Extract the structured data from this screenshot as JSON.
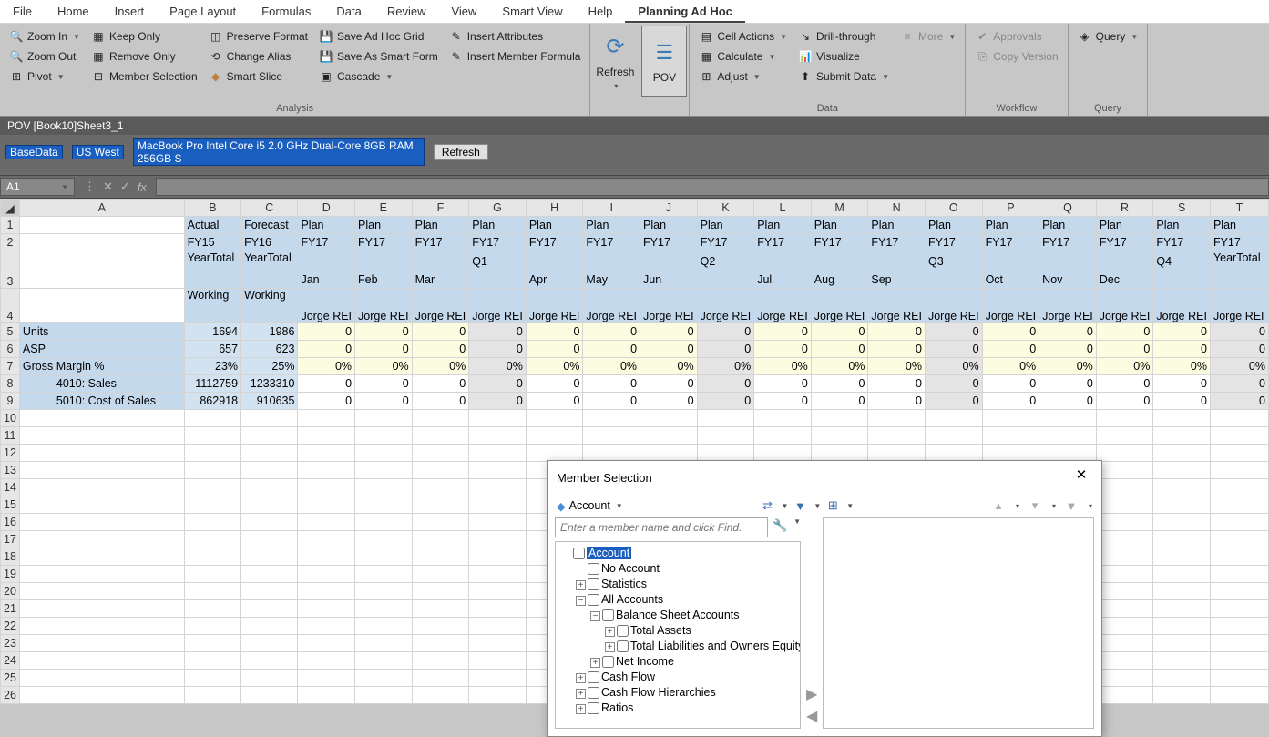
{
  "menu": [
    "File",
    "Home",
    "Insert",
    "Page Layout",
    "Formulas",
    "Data",
    "Review",
    "View",
    "Smart View",
    "Help",
    "Planning Ad Hoc"
  ],
  "menu_active": 10,
  "ribbon": {
    "analysis": {
      "label": "Analysis",
      "col1": [
        "Zoom In",
        "Zoom Out",
        "Pivot"
      ],
      "col2": [
        "Keep Only",
        "Remove Only",
        "Member Selection"
      ],
      "col3": [
        "Preserve Format",
        "Change Alias",
        "Smart Slice"
      ],
      "col4": [
        "Save Ad Hoc Grid",
        "Save As Smart Form",
        "Cascade"
      ],
      "col5": [
        "Insert Attributes",
        "Insert Member Formula"
      ]
    },
    "refresh": "Refresh",
    "pov": "POV",
    "data": {
      "label": "Data",
      "col1": [
        "Cell Actions",
        "Calculate",
        "Adjust"
      ],
      "col2": [
        "Drill-through",
        "Visualize",
        "Submit Data"
      ],
      "col3": [
        "More"
      ]
    },
    "workflow": {
      "label": "Workflow",
      "col1": [
        "Approvals",
        "Copy Version"
      ]
    },
    "query": {
      "label": "Query",
      "col1": [
        "Query"
      ]
    }
  },
  "pov": {
    "title": "POV [Book10]Sheet3_1",
    "chips": [
      "BaseData",
      "US West",
      "MacBook Pro Intel Core i5 2.0 GHz Dual-Core 8GB RAM  256GB S"
    ],
    "refresh": "Refresh"
  },
  "namebox": "A1",
  "cols": [
    "A",
    "B",
    "C",
    "D",
    "E",
    "F",
    "G",
    "H",
    "I",
    "J",
    "K",
    "L",
    "M",
    "N",
    "O",
    "P",
    "Q",
    "R",
    "S",
    "T"
  ],
  "grid": {
    "row1": [
      "",
      "Actual",
      "Forecast",
      "Plan",
      "Plan",
      "Plan",
      "Plan",
      "Plan",
      "Plan",
      "Plan",
      "Plan",
      "Plan",
      "Plan",
      "Plan",
      "Plan",
      "Plan",
      "Plan",
      "Plan",
      "Plan",
      "Plan"
    ],
    "row2": [
      "",
      "FY15",
      "FY16",
      "FY17",
      "FY17",
      "FY17",
      "FY17",
      "FY17",
      "FY17",
      "FY17",
      "FY17",
      "FY17",
      "FY17",
      "FY17",
      "FY17",
      "FY17",
      "FY17",
      "FY17",
      "FY17",
      "FY17"
    ],
    "row3": [
      "",
      "YearTotal",
      "YearTotal",
      "",
      "",
      "",
      "Q1",
      "",
      "",
      "",
      "Q2",
      "",
      "",
      "",
      "Q3",
      "",
      "",
      "",
      "Q4",
      "YearTotal"
    ],
    "row3b": [
      "",
      "",
      "",
      "Jan",
      "Feb",
      "Mar",
      "",
      "Apr",
      "May",
      "Jun",
      "",
      "Jul",
      "Aug",
      "Sep",
      "",
      "Oct",
      "Nov",
      "Dec",
      "",
      ""
    ],
    "row4": [
      "",
      "Working",
      "Working",
      "Jorge REI",
      "Jorge REI",
      "Jorge REI",
      "Jorge REI",
      "Jorge REI",
      "Jorge REI",
      "Jorge REI",
      "Jorge REI",
      "Jorge REI",
      "Jorge REI",
      "Jorge REI",
      "Jorge REI",
      "Jorge REI",
      "Jorge REI",
      "Jorge REI",
      "Jorge REI",
      "Jorge REI"
    ],
    "row5": [
      "Units",
      "1694",
      "1986",
      "0",
      "0",
      "0",
      "0",
      "0",
      "0",
      "0",
      "0",
      "0",
      "0",
      "0",
      "0",
      "0",
      "0",
      "0",
      "0",
      "0"
    ],
    "row6": [
      "ASP",
      "657",
      "623",
      "0",
      "0",
      "0",
      "0",
      "0",
      "0",
      "0",
      "0",
      "0",
      "0",
      "0",
      "0",
      "0",
      "0",
      "0",
      "0",
      "0"
    ],
    "row7": [
      "Gross Margin %",
      "23%",
      "25%",
      "0%",
      "0%",
      "0%",
      "0%",
      "0%",
      "0%",
      "0%",
      "0%",
      "0%",
      "0%",
      "0%",
      "0%",
      "0%",
      "0%",
      "0%",
      "0%",
      "0%"
    ],
    "row8": [
      "4010: Sales",
      "1112759",
      "1233310",
      "0",
      "0",
      "0",
      "0",
      "0",
      "0",
      "0",
      "0",
      "0",
      "0",
      "0",
      "0",
      "0",
      "0",
      "0",
      "0",
      "0"
    ],
    "row9": [
      "5010: Cost of Sales",
      "862918",
      "910635",
      "0",
      "0",
      "0",
      "0",
      "0",
      "0",
      "0",
      "0",
      "0",
      "0",
      "0",
      "0",
      "0",
      "0",
      "0",
      "0",
      "0"
    ]
  },
  "dialog": {
    "title": "Member Selection",
    "dim": "Account",
    "placeholder": "Enter a member name and click Find.",
    "tree": {
      "root": "Account",
      "l1": [
        "No Account",
        "Statistics",
        "All Accounts",
        "Cash Flow",
        "Cash Flow Hierarchies",
        "Ratios"
      ],
      "allacc": [
        "Balance Sheet Accounts",
        "Net Income"
      ],
      "bsa": [
        "Total Assets",
        "Total Liabilities and Owners Equity"
      ]
    }
  }
}
